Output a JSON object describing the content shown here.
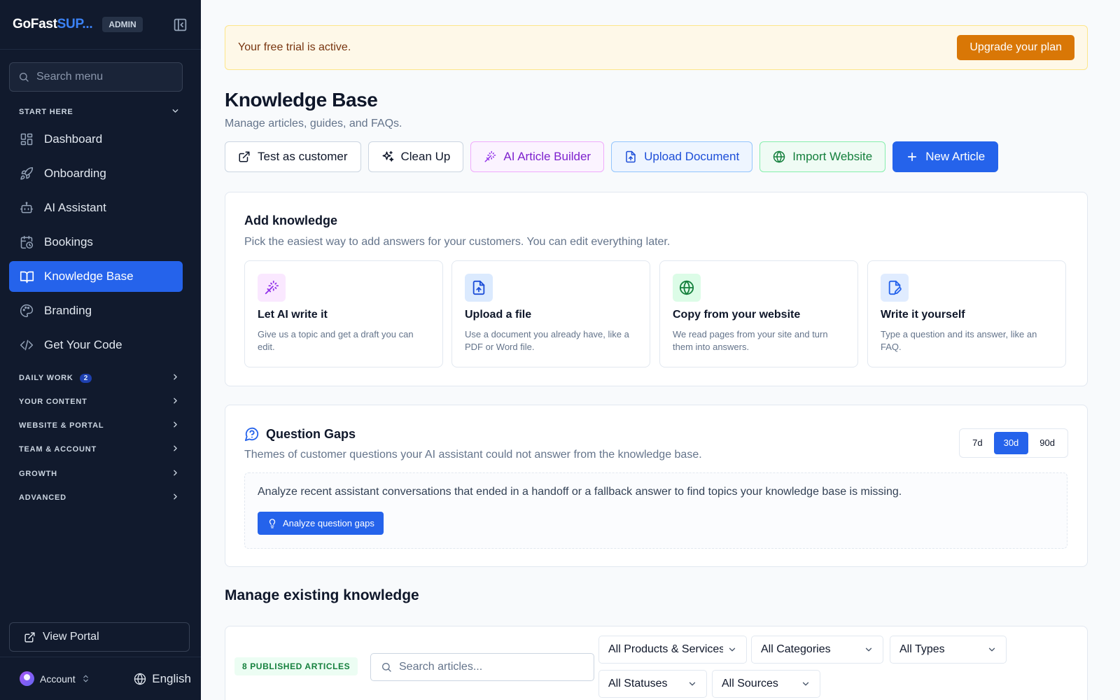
{
  "sidebar": {
    "brand_prefix": "GoFast",
    "brand_accent": "SUP...",
    "admin_badge": "ADMIN",
    "search_placeholder": "Search menu",
    "start_here_label": "START HERE",
    "items": [
      {
        "label": "Dashboard",
        "icon": "dashboard-icon"
      },
      {
        "label": "Onboarding",
        "icon": "rocket-icon"
      },
      {
        "label": "AI Assistant",
        "icon": "bot-icon"
      },
      {
        "label": "Bookings",
        "icon": "calendar-clock-icon"
      },
      {
        "label": "Knowledge Base",
        "icon": "book-open-icon",
        "active": true
      },
      {
        "label": "Branding",
        "icon": "palette-icon"
      },
      {
        "label": "Get Your Code",
        "icon": "code-icon"
      }
    ],
    "sections": [
      {
        "label": "DAILY WORK",
        "badge": "2"
      },
      {
        "label": "YOUR CONTENT"
      },
      {
        "label": "WEBSITE & PORTAL"
      },
      {
        "label": "TEAM & ACCOUNT"
      },
      {
        "label": "GROWTH"
      },
      {
        "label": "ADVANCED"
      }
    ],
    "view_portal": "View Portal",
    "account_label": "Account",
    "language": "English"
  },
  "banner": {
    "text": "Your free trial is active.",
    "button": "Upgrade your plan"
  },
  "page": {
    "title": "Knowledge Base",
    "subtitle": "Manage articles, guides, and FAQs."
  },
  "actions": {
    "test": "Test as customer",
    "cleanup": "Clean Up",
    "ai_builder": "AI Article Builder",
    "upload": "Upload Document",
    "import": "Import Website",
    "new_article": "New Article"
  },
  "add_knowledge": {
    "title": "Add knowledge",
    "subtitle": "Pick the easiest way to add answers for your customers. You can edit everything later.",
    "tiles": [
      {
        "title": "Let AI write it",
        "desc": "Give us a topic and get a draft you can edit.",
        "icon": "magic-wand-icon"
      },
      {
        "title": "Upload a file",
        "desc": "Use a document you already have, like a PDF or Word file.",
        "icon": "file-upload-icon"
      },
      {
        "title": "Copy from your website",
        "desc": "We read pages from your site and turn them into answers.",
        "icon": "globe-icon"
      },
      {
        "title": "Write it yourself",
        "desc": "Type a question and its answer, like an FAQ.",
        "icon": "file-pen-icon"
      }
    ]
  },
  "gaps": {
    "title": "Question Gaps",
    "subtitle": "Themes of customer questions your AI assistant could not answer from the knowledge base.",
    "ranges": [
      "7d",
      "30d",
      "90d"
    ],
    "active_range": "30d",
    "empty_text": "Analyze recent assistant conversations that ended in a handoff or a fallback answer to find topics your knowledge base is missing.",
    "analyze_button": "Analyze question gaps"
  },
  "manage": {
    "title": "Manage existing knowledge",
    "published_badge": "8 PUBLISHED ARTICLES",
    "search_placeholder": "Search articles...",
    "filters": {
      "products": "All Products & Services",
      "categories": "All Categories",
      "types": "All Types",
      "statuses": "All Statuses",
      "sources": "All Sources"
    }
  },
  "colors": {
    "sidebar_bg": "#111a2d",
    "accent": "#2563eb",
    "upgrade": "#d97706"
  }
}
